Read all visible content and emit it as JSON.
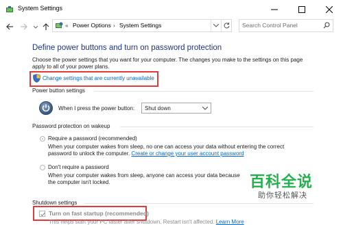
{
  "window": {
    "title": "System Settings"
  },
  "nav": {
    "breadcrumb_prefix": "«",
    "breadcrumb_1": "Power Options",
    "breadcrumb_sep": "›",
    "breadcrumb_2": "System Settings",
    "search_placeholder": "Search Control Panel"
  },
  "main": {
    "heading": "Define power buttons and turn on password protection",
    "description": "Choose the power settings that you want for your computer. The changes you make to the settings on this page apply to all of your power plans.",
    "change_link": "Change settings that are currently unavailable"
  },
  "power_button": {
    "section_title": "Power button settings",
    "label": "When I press the power button:",
    "selected": "Shut down"
  },
  "password": {
    "section_title": "Password protection on wakeup",
    "require_label": "Require a password (recommended)",
    "require_desc": "When your computer wakes from sleep, no one can access your data without entering the correct password to unlock the computer.",
    "require_link": "Create or change your user account password",
    "dont_label": "Don't require a password",
    "dont_desc": "When your computer wakes from sleep, anyone can access your data because the computer isn't locked."
  },
  "shutdown": {
    "section_title": "Shutdown settings",
    "fast_startup_label": "Turn on fast startup (recommended)",
    "fast_startup_desc": "This helps start your PC faster after shutdown. Restart isn't affected.",
    "learn_more": "Learn More"
  },
  "watermark": {
    "title": "百科全说",
    "subtitle": "助你轻松解决"
  },
  "colors": {
    "heading": "#1e3287",
    "link": "#0066cc",
    "highlight": "#e23a3a",
    "watermark": "#22b14c"
  },
  "icons": [
    "app-icon",
    "minimize-icon",
    "maximize-icon",
    "close-icon",
    "back-icon",
    "forward-icon",
    "recent-dropdown-icon",
    "up-icon",
    "control-panel-icon",
    "address-dropdown-icon",
    "refresh-icon",
    "search-icon",
    "shield-icon",
    "power-icon",
    "chevron-down-icon",
    "checkmark-icon"
  ]
}
